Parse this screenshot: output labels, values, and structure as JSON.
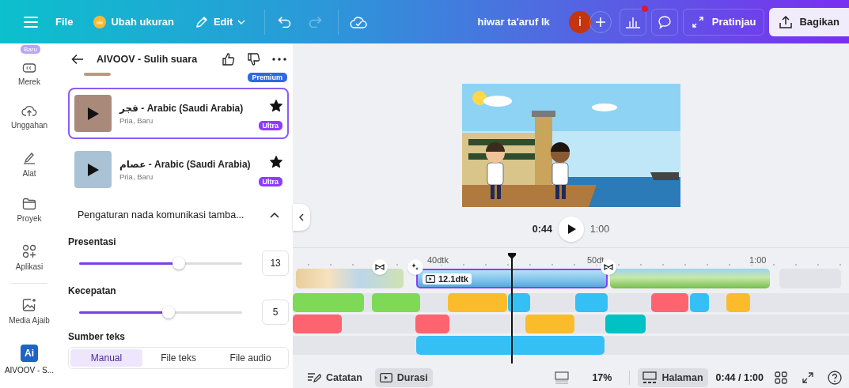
{
  "topbar": {
    "file_menu": "File",
    "resize_button": "Ubah ukuran",
    "edit_button": "Edit",
    "redo": {
      "disabled": true
    },
    "design_title": "hiwar ta'aruf lk",
    "avatar_initial": "i",
    "analytics_dot": true,
    "preview_button": "Pratinjau",
    "share_button": "Bagikan"
  },
  "rail": [
    {
      "kind": "brand",
      "label": "Merek",
      "badge": "Baru"
    },
    {
      "kind": "upload",
      "label": "Unggahan"
    },
    {
      "kind": "tools",
      "label": "Alat"
    },
    {
      "kind": "projects",
      "label": "Proyek"
    },
    {
      "kind": "apps",
      "label": "Aplikasi"
    },
    {
      "kind": "magic",
      "label": "Media Ajaib"
    },
    {
      "kind": "app",
      "label": "AIVOOV - S...",
      "initials": "Ai",
      "selected": true
    }
  ],
  "panel": {
    "title": "AIVOOV - Sulih suara",
    "partial_badge": "Premium",
    "voices": [
      {
        "name": "فجر - Arabic (Saudi Arabia)",
        "details": "Pria, Baru",
        "selected": true,
        "favorite": true,
        "tier": "Ultra"
      },
      {
        "name": "عصام - Arabic (Saudi Arabia)",
        "details": "Pria, Baru",
        "selected": false,
        "favorite": true,
        "tier": "Ultra"
      }
    ],
    "tone_section": {
      "title": "Pengaturan nada komunikasi tamba...",
      "expanded": true
    },
    "sliders": [
      {
        "label": "Presentasi",
        "level": 0.61,
        "value": "13"
      },
      {
        "label": "Kecepatan",
        "level": 0.55,
        "value": "5"
      }
    ],
    "source": {
      "label": "Sumber teks",
      "options": [
        {
          "label": "Manual",
          "selected": true
        },
        {
          "label": "File teks",
          "selected": false
        },
        {
          "label": "File audio",
          "selected": false
        }
      ]
    }
  },
  "preview": {
    "current_time": "0:44",
    "duration": "1:00"
  },
  "timeline": {
    "ruler": [
      "40dtk",
      "50dt",
      "1:00"
    ],
    "video_clip_label": "12.1dtk",
    "audio_tracks": [
      {
        "clips": [
          {
            "color": "#7ed957"
          },
          {
            "color": "#7ed957"
          },
          {
            "color": "#fbbc2c"
          },
          {
            "color": "#35c0f5"
          },
          {
            "color": "#35c0f5"
          },
          {
            "color": "#fe6370"
          },
          {
            "color": "#35c0f5"
          },
          {
            "color": "#fbbc2c"
          }
        ]
      },
      {
        "clips": [
          {
            "color": "#fe6370"
          },
          {
            "color": "#fe6370"
          },
          {
            "color": "#fbbc2c"
          },
          {
            "color": "#00c2c4"
          }
        ]
      },
      {
        "clips": [
          {
            "color": "#35c0f5"
          }
        ]
      }
    ]
  },
  "bottom_bar": {
    "notes": "Catatan",
    "duration": {
      "label": "Durasi",
      "selected": true
    },
    "zoom": "17%",
    "pages": {
      "label": "Halaman",
      "selected": true
    },
    "time": "0:44 / 1:00"
  }
}
